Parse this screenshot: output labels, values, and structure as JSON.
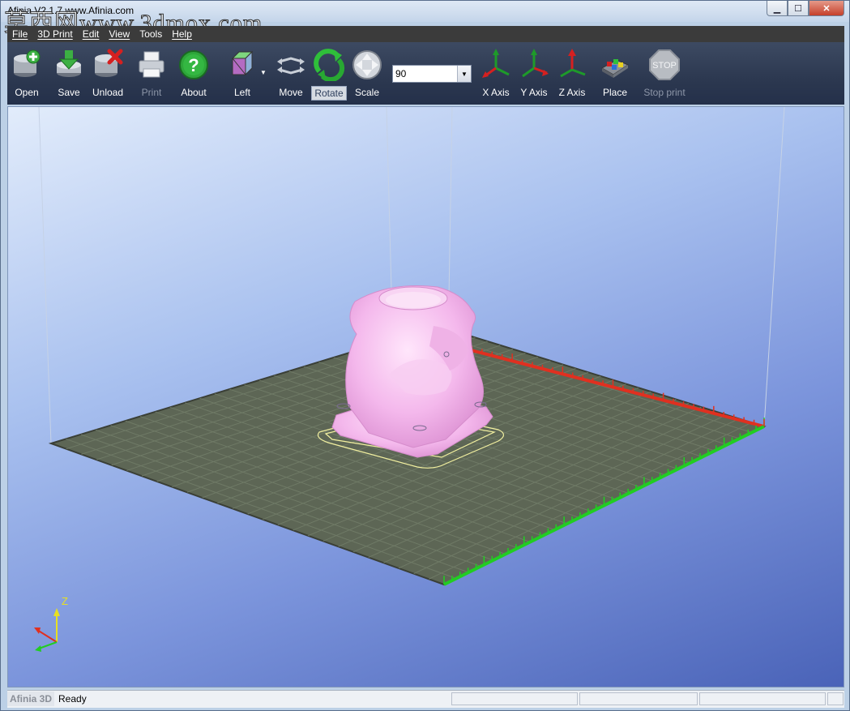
{
  "window": {
    "title": "Afinia V2.1.7  www.Afinia.com",
    "watermark": "莫西网www.3dmox.com",
    "buttons": {
      "minimize": "▁",
      "maximize": "☐",
      "close": "✕"
    }
  },
  "menu": {
    "items": [
      "File",
      "3D Print",
      "Edit",
      "View",
      "Tools",
      "Help"
    ]
  },
  "toolbar": {
    "open": "Open",
    "save": "Save",
    "unload": "Unload",
    "print": "Print",
    "about": "About",
    "view_left": "Left",
    "move": "Move",
    "rotate": "Rotate",
    "scale": "Scale",
    "amount_value": "90",
    "x_axis": "X Axis",
    "y_axis": "Y Axis",
    "z_axis": "Z Axis",
    "place": "Place",
    "stop_print": "Stop print",
    "stop_icon_text": "STOP"
  },
  "viewport": {
    "axis_z_label": "Z"
  },
  "status": {
    "brand": "Afinia 3D",
    "message": "Ready"
  },
  "colors": {
    "platform": "#5d6655",
    "model": "#f4b8ec",
    "x_axis": "#e03020",
    "y_axis": "#22cc22",
    "z_axis": "#e8e020"
  }
}
